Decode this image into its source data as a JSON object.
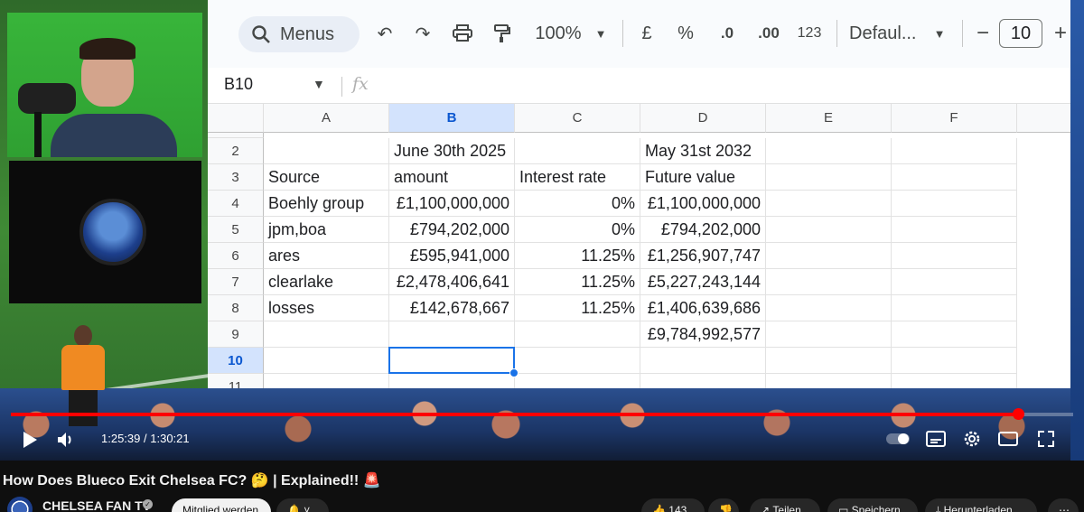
{
  "spreadsheet": {
    "search_label": "Menus",
    "zoom": "100%",
    "currency_symbol": "£",
    "percent_symbol": "%",
    "decrease_decimals": ".0",
    "increase_decimals": ".00",
    "number_format": "123",
    "font_name": "Defaul...",
    "font_size": "10",
    "name_box": "B10",
    "fx_label": "fx",
    "column_headers": [
      "A",
      "B",
      "C",
      "D",
      "E",
      "F"
    ],
    "selected_column": "B",
    "selected_row": "10",
    "rows": [
      {
        "num": "2",
        "cells": [
          "",
          "June 30th 2025",
          "",
          "May 31st 2032",
          "",
          ""
        ]
      },
      {
        "num": "3",
        "cells": [
          "Source",
          "amount",
          "Interest rate",
          "Future value",
          "",
          ""
        ]
      },
      {
        "num": "4",
        "cells": [
          "Boehly group",
          "£1,100,000,000",
          "0%",
          "£1,100,000,000",
          "",
          ""
        ]
      },
      {
        "num": "5",
        "cells": [
          "jpm,boa",
          "£794,202,000",
          "0%",
          "£794,202,000",
          "",
          ""
        ]
      },
      {
        "num": "6",
        "cells": [
          "ares",
          "£595,941,000",
          "11.25%",
          "£1,256,907,747",
          "",
          ""
        ]
      },
      {
        "num": "7",
        "cells": [
          "clearlake",
          "£2,478,406,641",
          "11.25%",
          "£5,227,243,144",
          "",
          ""
        ]
      },
      {
        "num": "8",
        "cells": [
          "losses",
          "£142,678,667",
          "11.25%",
          "£1,406,639,686",
          "",
          ""
        ]
      },
      {
        "num": "9",
        "cells": [
          "",
          "",
          "",
          "£9,784,992,577",
          "",
          ""
        ]
      },
      {
        "num": "10",
        "cells": [
          "",
          "",
          "",
          "",
          "",
          ""
        ]
      },
      {
        "num": "11",
        "cells": [
          "",
          "",
          "",
          "",
          "",
          ""
        ]
      }
    ]
  },
  "player": {
    "time_current": "1:25:39",
    "time_total": "1:30:21",
    "time_separator": "/",
    "progress_fraction": 0.948,
    "accent_color": "#ff0000"
  },
  "video": {
    "title": "How Does Blueco Exit Chelsea FC? 🤔 | Explained!! 🚨",
    "channel": "CHELSEA FAN TV",
    "join_label": "Mitglied werden",
    "like_count": "143",
    "share_label": "Teilen",
    "save_label": "Speichern",
    "download_label": "Herunterladen"
  }
}
